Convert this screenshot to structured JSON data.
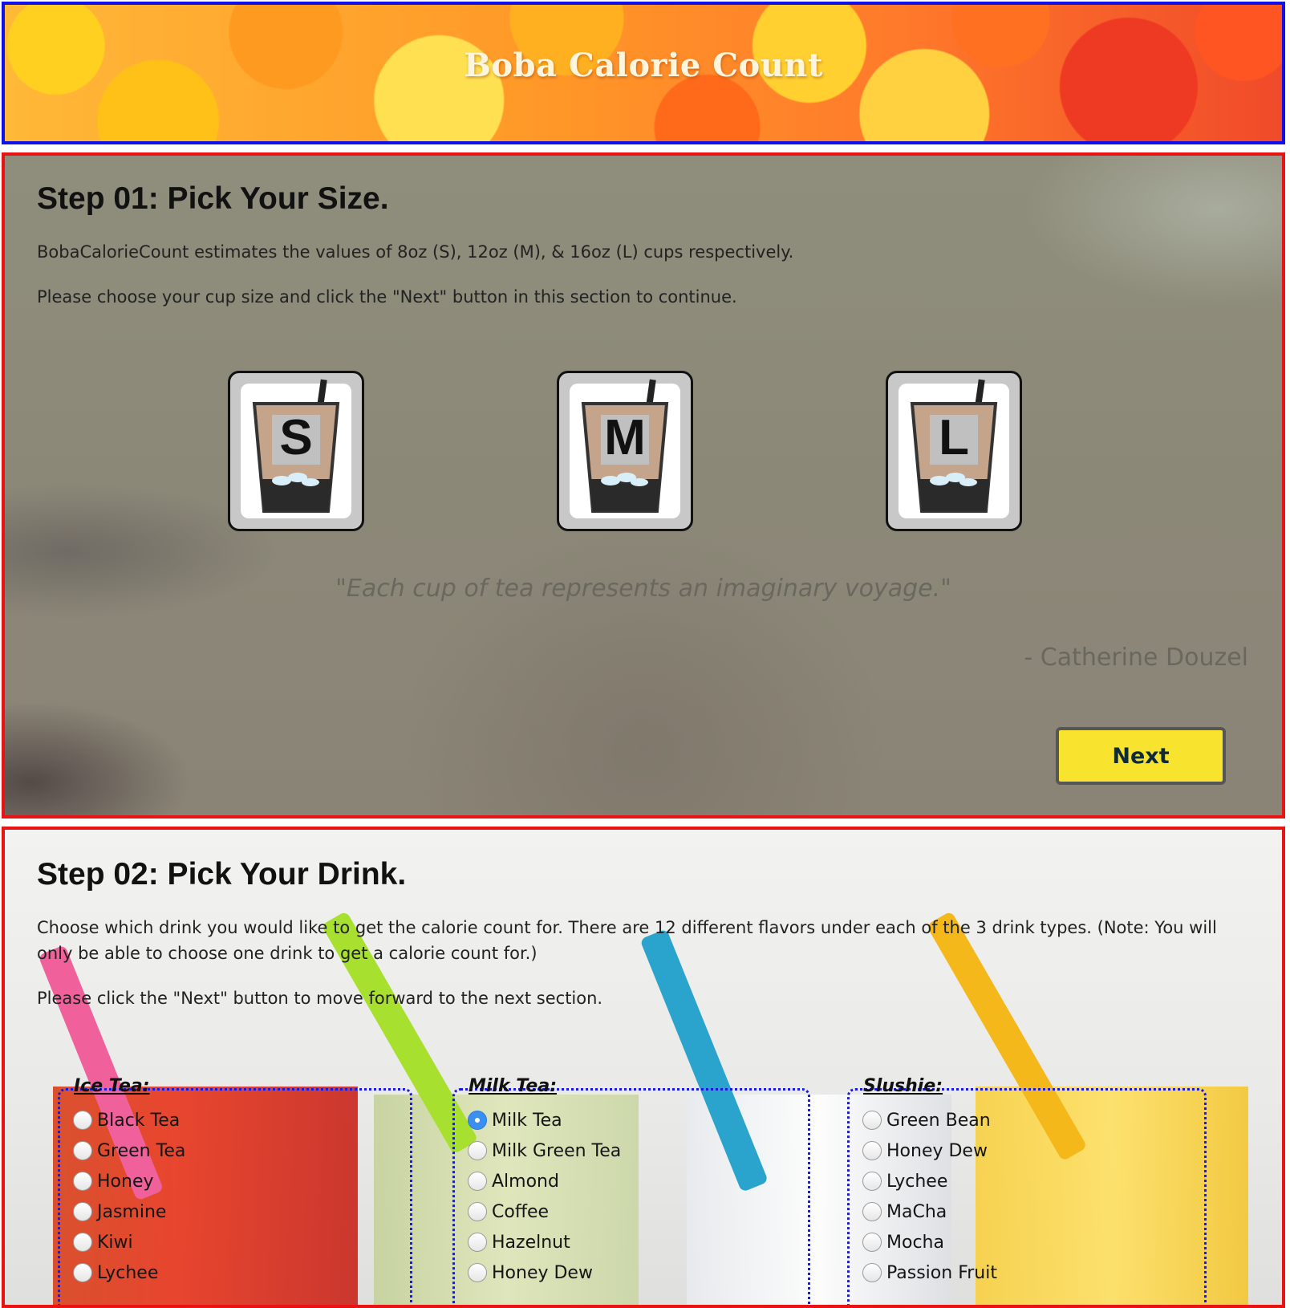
{
  "header": {
    "title": "Boba Calorie Count"
  },
  "step1": {
    "title": "Step 01: Pick Your Size.",
    "desc": "BobaCalorieCount estimates the values of 8oz (S), 12oz (M), & 16oz (L) cups respectively.",
    "instruction": "Please choose your cup size and click the \"Next\" button in this section to continue.",
    "sizes": [
      {
        "letter": "S",
        "icon": "cup-small-icon"
      },
      {
        "letter": "M",
        "icon": "cup-medium-icon"
      },
      {
        "letter": "L",
        "icon": "cup-large-icon"
      }
    ],
    "quote": "\"Each cup of tea represents an imaginary voyage.\"",
    "quote_author": "- Catherine Douzel",
    "next_label": "Next"
  },
  "step2": {
    "title": "Step 02: Pick Your Drink.",
    "desc": "Choose which drink you would like to get the calorie count for. There are 12 different flavors under each of the 3 drink types. (Note: You will only be able to choose one drink to get a calorie count for.)",
    "instruction": "Please click the \"Next\" button to move forward to the next section.",
    "groups": [
      {
        "legend": "Ice Tea:",
        "options": [
          "Black Tea",
          "Green Tea",
          "Honey",
          "Jasmine",
          "Kiwi",
          "Lychee"
        ]
      },
      {
        "legend": "Milk Tea:",
        "selected": "Milk Tea",
        "options": [
          "Milk Tea",
          "Milk Green Tea",
          "Almond",
          "Coffee",
          "Hazelnut",
          "Honey Dew"
        ]
      },
      {
        "legend": "Slushie:",
        "options": [
          "Green Bean",
          "Honey Dew",
          "Lychee",
          "MaCha",
          "Mocha",
          "Passion Fruit"
        ]
      }
    ]
  },
  "colors": {
    "header_border": "#1010e8",
    "section_border": "#e81414",
    "next_button": "#f8e32e",
    "group_border": "#1a1adb",
    "radio_selected": "#3b8ff0"
  }
}
